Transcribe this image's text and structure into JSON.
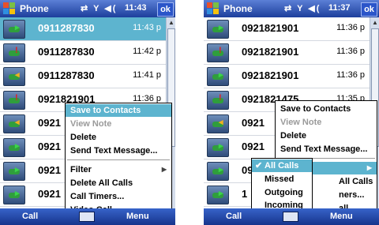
{
  "left": {
    "title": "Phone",
    "status_icons": "⇄ Y ◀(",
    "clock": "11:43",
    "ok": "ok",
    "calls": [
      {
        "number": "0911287830",
        "time": "11:43 p",
        "selected": true
      },
      {
        "number": "0911287830",
        "time": "11:42 p"
      },
      {
        "number": "0911287830",
        "time": "11:41 p"
      },
      {
        "number": "0921821901",
        "time": "11:36 p"
      },
      {
        "number": "0921",
        "time": ""
      },
      {
        "number": "0921",
        "time": ""
      },
      {
        "number": "0921",
        "time": ""
      },
      {
        "number": "0921",
        "time": ""
      }
    ],
    "menu": {
      "save": "Save to Contacts",
      "view_note": "View Note",
      "delete": "Delete",
      "send_text": "Send Text Message...",
      "filter": "Filter",
      "delete_all": "Delete All Calls",
      "timers": "Call Timers...",
      "video": "Video Call"
    },
    "softkeys": {
      "left": "Call",
      "right": "Menu"
    }
  },
  "right": {
    "title": "Phone",
    "status_icons": "⇄ Y ◀(",
    "clock": "11:37",
    "ok": "ok",
    "calls": [
      {
        "number": "0921821901",
        "time": "11:36 p"
      },
      {
        "number": "0921821901",
        "time": "11:36 p"
      },
      {
        "number": "0921821901",
        "time": "11:36 p"
      },
      {
        "number": "0921821475",
        "time": "11:35 p"
      },
      {
        "number": "0921",
        "time": ""
      },
      {
        "number": "0921",
        "time": ""
      },
      {
        "number": "0921",
        "time": ""
      },
      {
        "number": "1",
        "time": ""
      }
    ],
    "menu": {
      "save": "Save to Contacts",
      "view_note": "View Note",
      "delete": "Delete",
      "send_text": "Send Text Message...",
      "delete_all_part": "All Calls",
      "timers_part": "ners...",
      "video_part": "all"
    },
    "submenu": {
      "all": "All Calls",
      "missed": "Missed",
      "outgoing": "Outgoing",
      "incoming": "Incoming"
    },
    "softkeys": {
      "left": "Call",
      "right": "Menu"
    }
  },
  "colors": {
    "titlebar": "#1d3f9c",
    "highlight": "#5db4cf",
    "softbar": "#17348c"
  }
}
